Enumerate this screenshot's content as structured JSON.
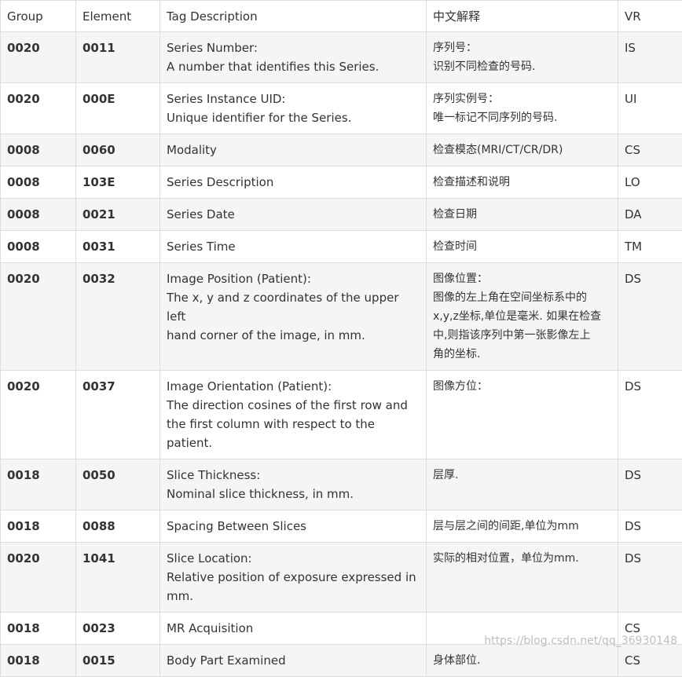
{
  "table": {
    "headers": {
      "group": "Group",
      "element": "Element",
      "description": "Tag Description",
      "chinese": "中文解释",
      "vr": "VR"
    },
    "rows": [
      {
        "group": "0020",
        "element": "0011",
        "desc": [
          "Series Number:",
          "A number that identifies this Series."
        ],
        "cn": [
          "序列号：",
          "识别不同检查的号码."
        ],
        "vr": "IS"
      },
      {
        "group": "0020",
        "element": "000E",
        "desc": [
          "Series Instance UID:",
          "Unique identifier for the Series."
        ],
        "cn": [
          "序列实例号：",
          "唯一标记不同序列的号码."
        ],
        "vr": "UI"
      },
      {
        "group": "0008",
        "element": "0060",
        "desc": [
          "Modality"
        ],
        "cn": [
          "检查模态(MRI/CT/CR/DR)"
        ],
        "vr": "CS"
      },
      {
        "group": "0008",
        "element": "103E",
        "desc": [
          "Series Description"
        ],
        "cn": [
          "检查描述和说明"
        ],
        "vr": "LO"
      },
      {
        "group": "0008",
        "element": "0021",
        "desc": [
          "Series Date"
        ],
        "cn": [
          "检查日期"
        ],
        "vr": "DA"
      },
      {
        "group": "0008",
        "element": "0031",
        "desc": [
          "Series Time"
        ],
        "cn": [
          "检查时间"
        ],
        "vr": "TM"
      },
      {
        "group": "0020",
        "element": "0032",
        "desc": [
          "Image Position (Patient):",
          "The x, y and z coordinates of the upper left",
          "hand corner of the image, in mm."
        ],
        "cn": [
          "图像位置：",
          "图像的左上角在空间坐标系中的",
          "x,y,z坐标,单位是毫米. 如果在检查",
          "中,则指该序列中第一张影像左上",
          "角的坐标."
        ],
        "vr": "DS"
      },
      {
        "group": "0020",
        "element": "0037",
        "desc": [
          "Image Orientation (Patient):",
          "The direction cosines of the first row and",
          "the first column with respect to the patient."
        ],
        "cn": [
          "图像方位："
        ],
        "vr": "DS"
      },
      {
        "group": "0018",
        "element": "0050",
        "desc": [
          "Slice Thickness:",
          "Nominal slice thickness, in mm."
        ],
        "cn": [
          "层厚."
        ],
        "vr": "DS"
      },
      {
        "group": "0018",
        "element": "0088",
        "desc": [
          "Spacing Between Slices"
        ],
        "cn": [
          "层与层之间的间距,单位为mm"
        ],
        "vr": "DS"
      },
      {
        "group": "0020",
        "element": "1041",
        "desc": [
          "Slice Location:",
          "Relative position of exposure expressed in",
          "mm."
        ],
        "cn": [
          "实际的相对位置，单位为mm."
        ],
        "vr": "DS"
      },
      {
        "group": "0018",
        "element": "0023",
        "desc": [
          "MR Acquisition"
        ],
        "cn": [],
        "vr": "CS"
      },
      {
        "group": "0018",
        "element": "0015",
        "desc": [
          "Body Part Examined"
        ],
        "cn": [
          "身体部位."
        ],
        "vr": "CS"
      }
    ]
  },
  "watermark": "https://blog.csdn.net/qq_36930148"
}
